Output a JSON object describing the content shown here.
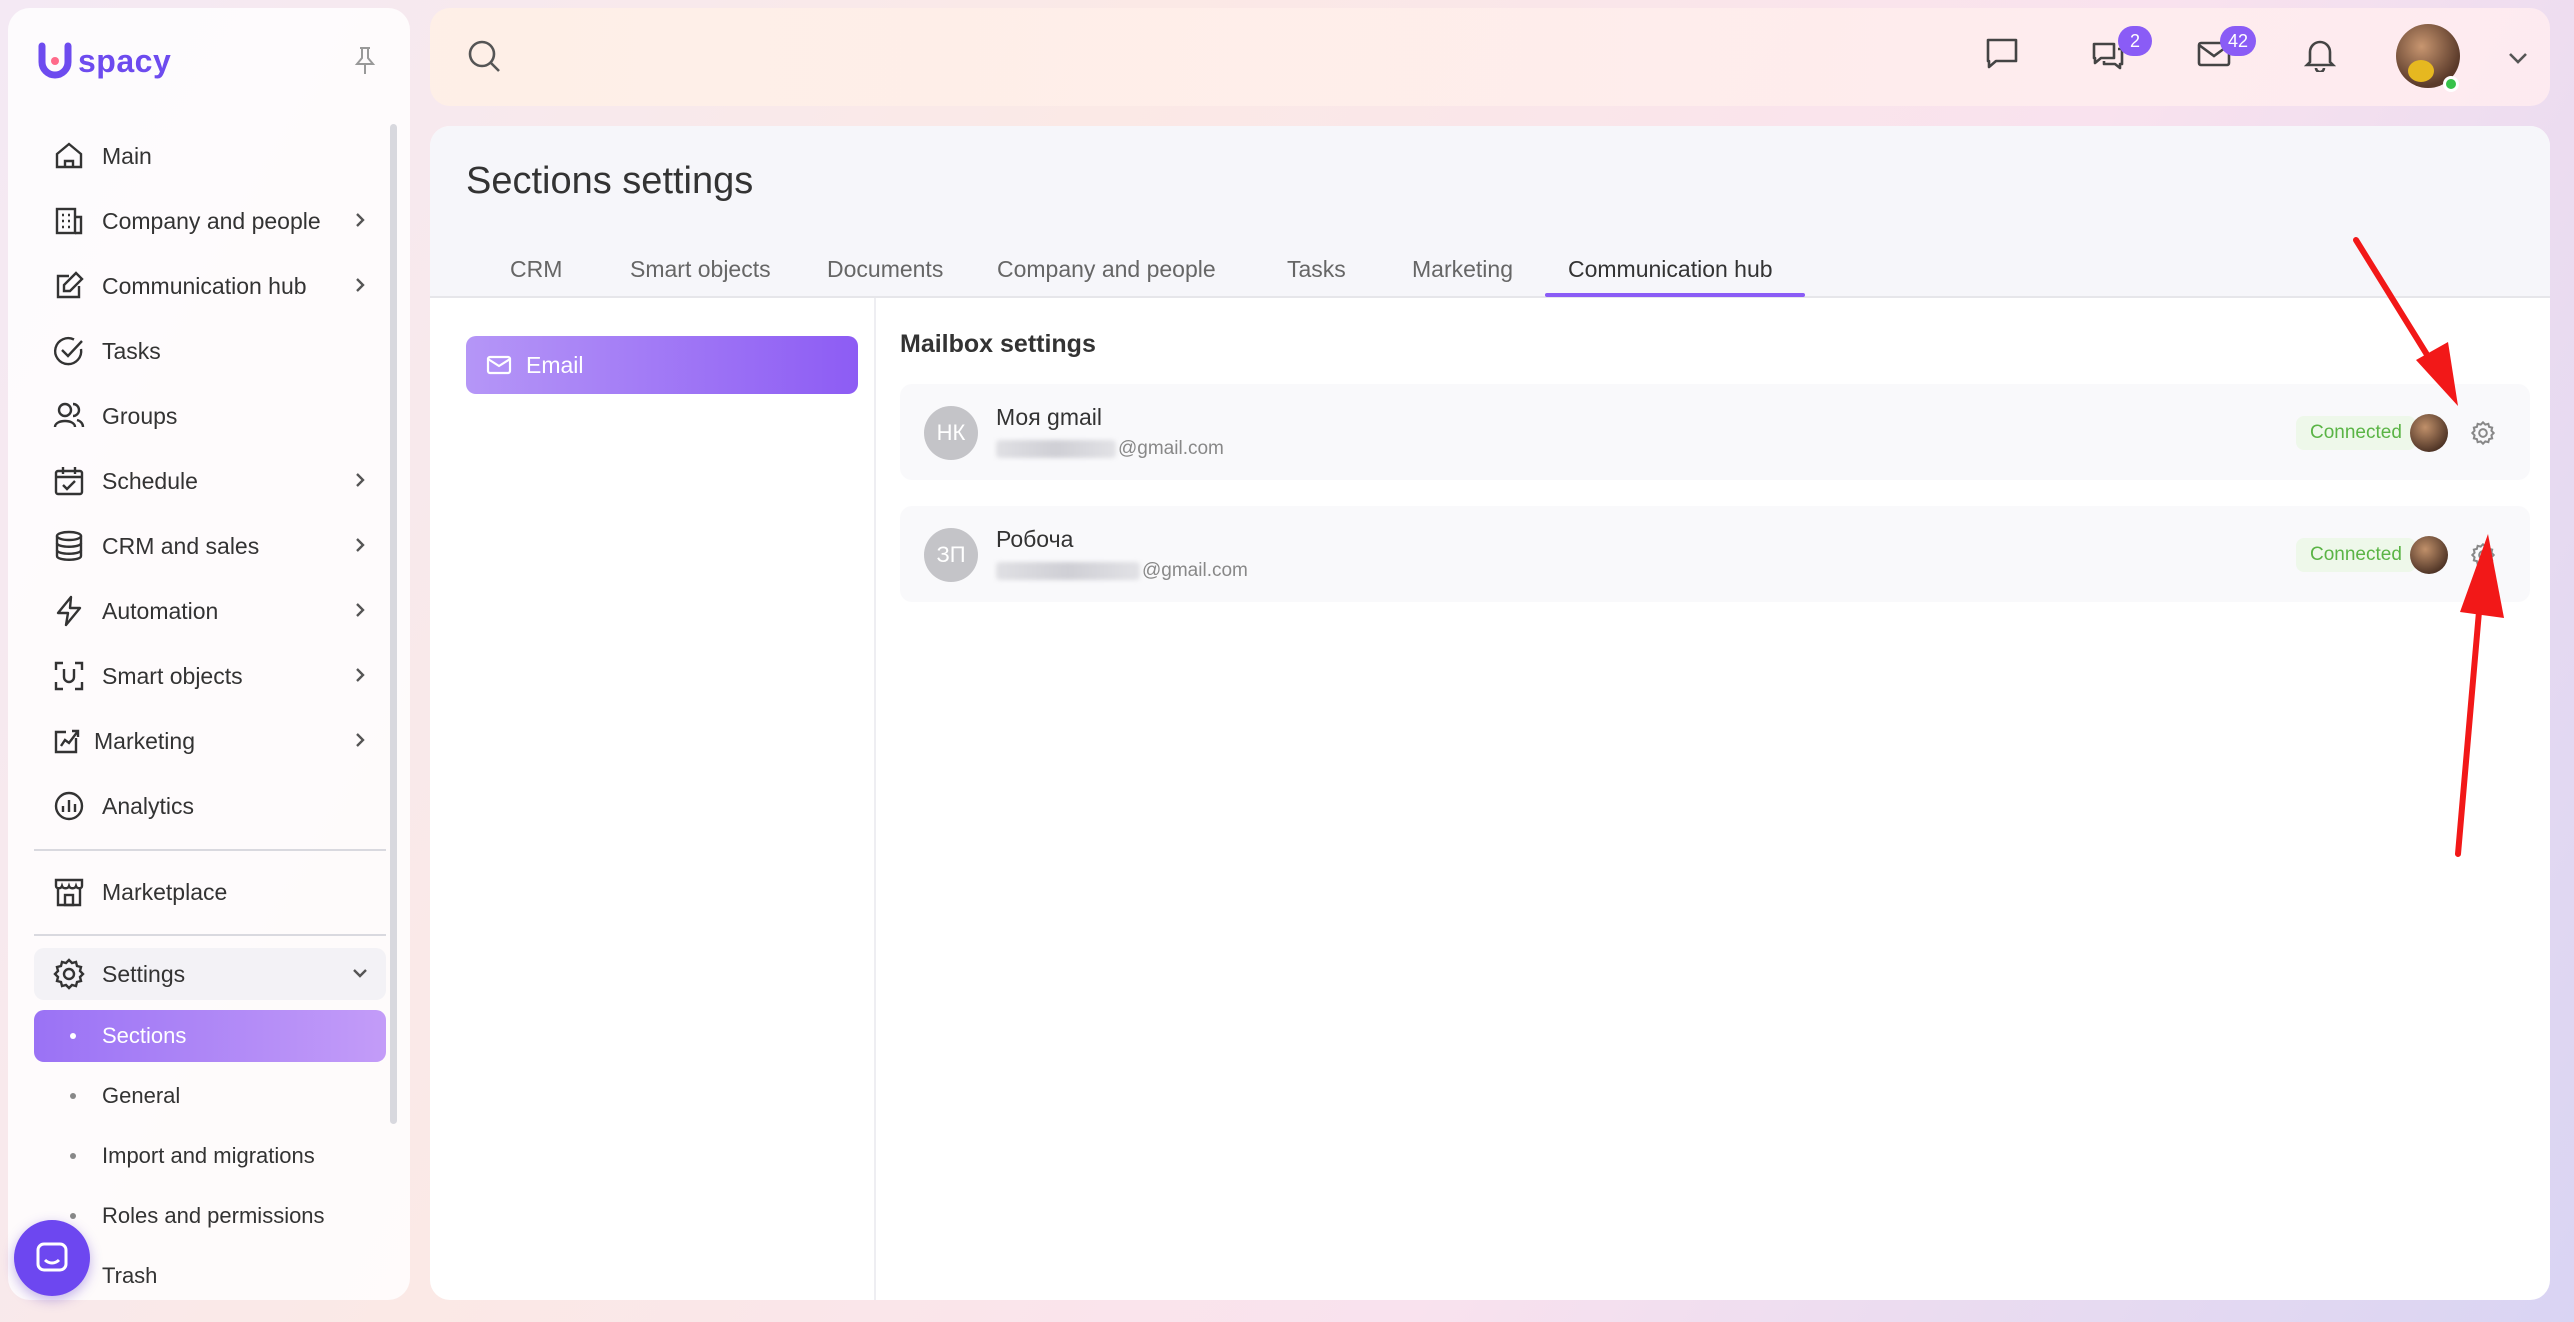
{
  "app": {
    "logo_letter": "U",
    "logo_text": "spacy",
    "accent": "#8a5cf6"
  },
  "sidebar": {
    "items": [
      {
        "label": "Main",
        "icon": "home-icon",
        "has_children": false
      },
      {
        "label": "Company and people",
        "icon": "building-icon",
        "has_children": true
      },
      {
        "label": "Communication hub",
        "icon": "edit-chat-icon",
        "has_children": true
      },
      {
        "label": "Tasks",
        "icon": "check-circle-icon",
        "has_children": false
      },
      {
        "label": "Groups",
        "icon": "users-icon",
        "has_children": false
      },
      {
        "label": "Schedule",
        "icon": "calendar-icon",
        "has_children": true
      },
      {
        "label": "CRM and sales",
        "icon": "database-icon",
        "has_children": true
      },
      {
        "label": "Automation",
        "icon": "lightning-icon",
        "has_children": true
      },
      {
        "label": "Smart objects",
        "icon": "scan-icon",
        "has_children": true
      },
      {
        "label": "Marketing",
        "icon": "megaphone-icon",
        "has_children": true
      },
      {
        "label": "Analytics",
        "icon": "chart-circle-icon",
        "has_children": false
      }
    ],
    "marketplace": "Marketplace",
    "settings": "Settings",
    "settings_children": [
      "Sections",
      "General",
      "Import and migrations",
      "Roles and permissions",
      "Trash"
    ],
    "active_child": "Sections"
  },
  "topbar": {
    "search_icon": "search-icon",
    "chats_badge": "2",
    "mail_badge": "42"
  },
  "main": {
    "title": "Sections settings",
    "tabs": [
      "CRM",
      "Smart objects",
      "Documents",
      "Company and people",
      "Tasks",
      "Marketing",
      "Communication hub"
    ],
    "active_tab": "Communication hub",
    "left_menu": {
      "email": "Email"
    },
    "mailbox_title": "Mailbox settings",
    "mailboxes": [
      {
        "initials": "НК",
        "name": "Моя gmail",
        "email_suffix": "@gmail.com",
        "status": "Connected"
      },
      {
        "initials": "ЗП",
        "name": "Робоча",
        "email_suffix": "@gmail.com",
        "status": "Connected"
      }
    ]
  }
}
